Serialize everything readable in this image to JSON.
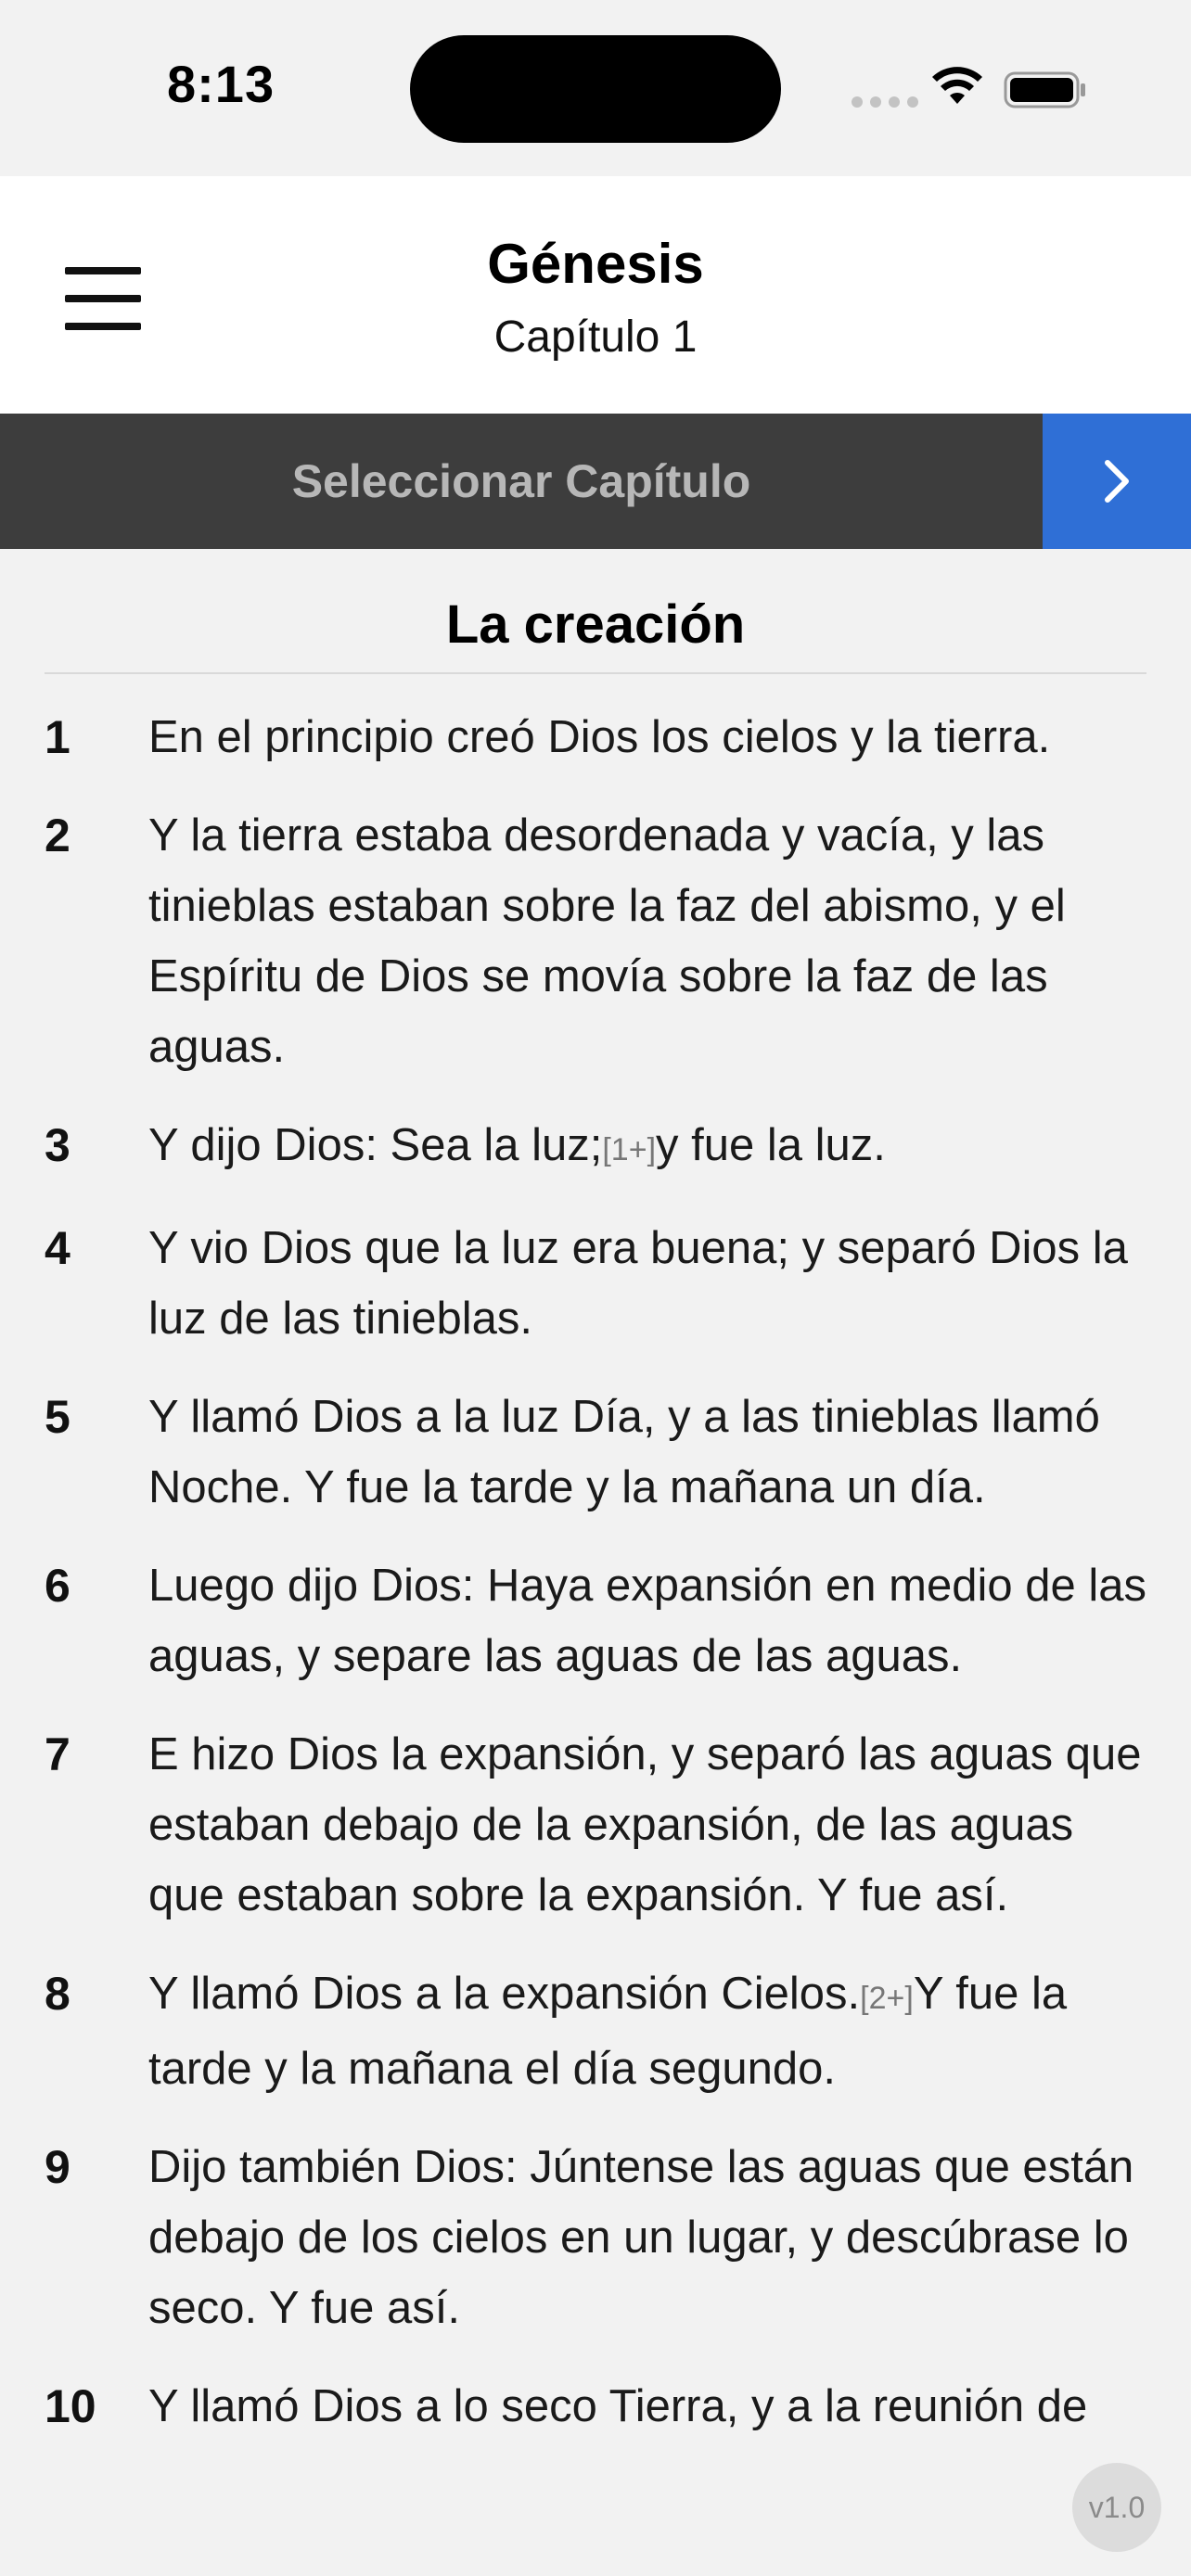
{
  "status_bar": {
    "time": "8:13"
  },
  "header": {
    "book": "Génesis",
    "chapter": "Capítulo 1"
  },
  "chapter_bar": {
    "select_label": "Seleccionar Capítulo",
    "next_icon": "chevron-right-icon"
  },
  "colors": {
    "accent": "#2f6fd6",
    "bar_background": "#3d3d3d",
    "page_background": "#f2f2f2"
  },
  "section": {
    "title": "La creación"
  },
  "verses": [
    {
      "number": "1",
      "text": "En el principio creó Dios los cielos y la tierra."
    },
    {
      "number": "2",
      "text": "Y la tierra estaba desordenada y vacía, y las tinieblas estaban sobre la faz del abismo, y el Espíritu de Dios se movía sobre la faz de las aguas."
    },
    {
      "number": "3",
      "before": "Y dijo Dios: Sea la luz;",
      "footnote": "[1+]",
      "after": "y fue la luz."
    },
    {
      "number": "4",
      "text": "Y vio Dios que la luz era buena; y separó Dios la luz de las tinieblas."
    },
    {
      "number": "5",
      "text": "Y llamó Dios a la luz Día, y a las tinieblas llamó Noche. Y fue la tarde y la mañana un día."
    },
    {
      "number": "6",
      "text": "Luego dijo Dios: Haya expansión en medio de las aguas, y separe las aguas de las aguas."
    },
    {
      "number": "7",
      "text": "E hizo Dios la expansión, y separó las aguas que estaban debajo de la expansión, de las aguas que estaban sobre la expansión. Y fue así."
    },
    {
      "number": "8",
      "before": "Y llamó Dios a la expansión Cielos.",
      "footnote": "[2+]",
      "after": "Y fue la tarde y la mañana el día segundo."
    },
    {
      "number": "9",
      "text": "Dijo también Dios: Júntense las aguas que están debajo de los cielos en un lugar, y descúbrase lo seco. Y fue así."
    },
    {
      "number": "10",
      "text": "Y llamó Dios a lo seco Tierra, y a la reunión de"
    }
  ],
  "version": "v1.0"
}
